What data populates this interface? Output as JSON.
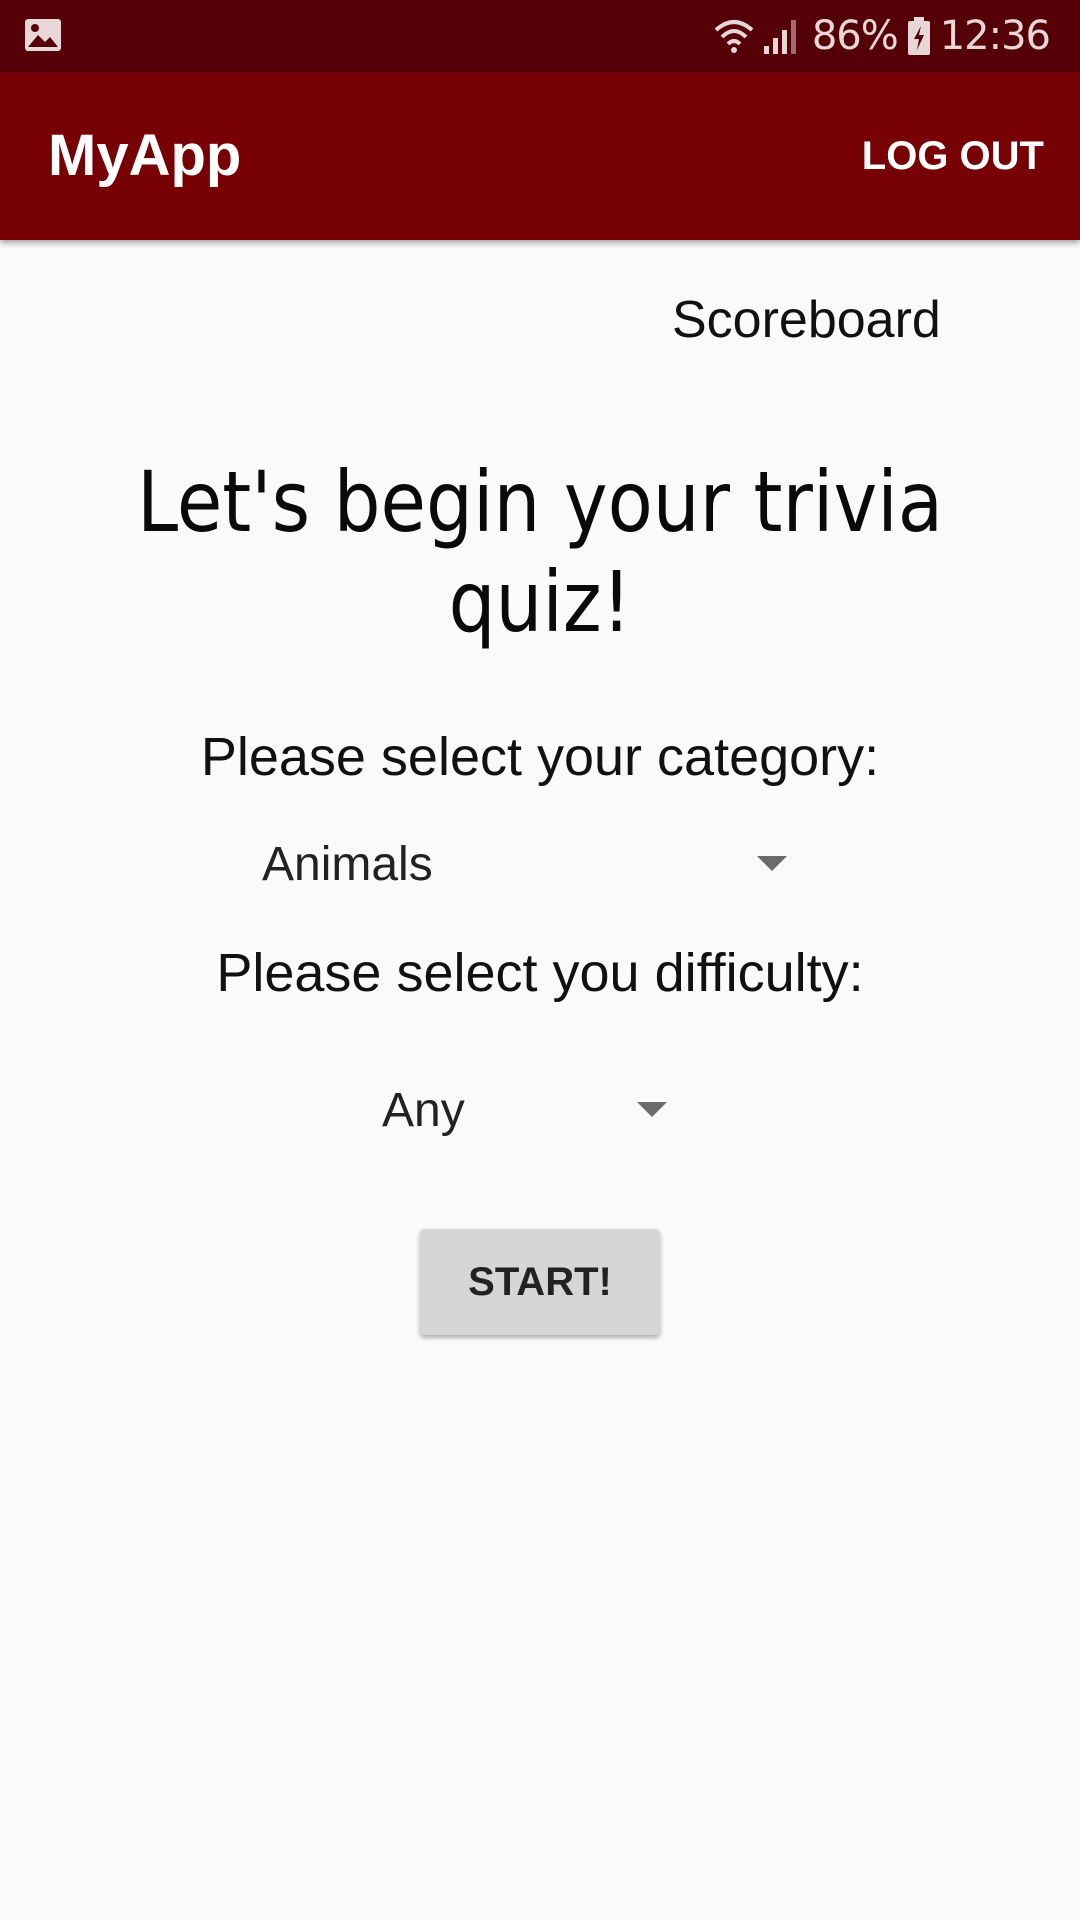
{
  "status_bar": {
    "battery_percent": "86%",
    "time": "12:36",
    "icons": [
      "gallery-icon",
      "wifi-icon",
      "signal-icon",
      "battery-icon"
    ]
  },
  "app_bar": {
    "title": "MyApp",
    "logout_label": "LOG OUT"
  },
  "scoreboard_label": "Scoreboard",
  "headline": "Let's begin your trivia quiz!",
  "category": {
    "prompt": "Please select your category:",
    "selected": "Animals"
  },
  "difficulty": {
    "prompt": "Please select you difficulty:",
    "selected": "Any"
  },
  "start_label": "START!",
  "colors": {
    "status_bar": "#540006",
    "app_bar": "#760004",
    "background": "#fafafa",
    "button": "#d6d6d6"
  }
}
